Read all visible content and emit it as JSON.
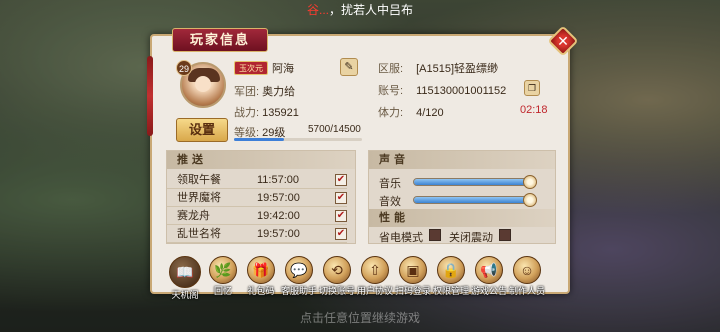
{
  "marquee": {
    "prefix": "",
    "name": "谷...",
    "suffix": "，扰若人中吕布"
  },
  "bottom_hint": "点击任意位置继续游戏",
  "panel": {
    "title": "玩家信息",
    "close_icon": "close-icon"
  },
  "player": {
    "level_badge": "29",
    "vip_tag": "玉次元",
    "name": "阿海",
    "legion_label": "军团:",
    "legion": "奥力给",
    "power_label": "战力:",
    "power": "135921",
    "level_label": "等级:",
    "level": "29级",
    "exp": "5700/14500",
    "exp_fraction": 0.393,
    "server_label": "区服:",
    "server": "[A1515]轻盈缥缈",
    "account_label": "账号:",
    "account": "115130001001152",
    "stamina_label": "体力:",
    "stamina": "4/120",
    "stamina_timer": "02:18",
    "setup_button": "设置"
  },
  "push": {
    "header": "推送",
    "items": [
      {
        "name": "领取午餐",
        "time": "11:57:00",
        "checked": "✔"
      },
      {
        "name": "世界魔将",
        "time": "19:57:00",
        "checked": "✔"
      },
      {
        "name": "赛龙舟",
        "time": "19:42:00",
        "checked": "✔"
      },
      {
        "name": "乱世名将",
        "time": "19:57:00",
        "checked": "✔"
      }
    ]
  },
  "sound": {
    "header": "声音",
    "music_label": "音乐",
    "music_level": 0.98,
    "effect_label": "音效",
    "effect_level": 0.98
  },
  "performance": {
    "header": "性能",
    "power_save_label": "省电模式",
    "vibration_off_label": "关闭震动"
  },
  "bottom_icons": [
    {
      "label": "天机阁",
      "glyph": "📖"
    },
    {
      "label": "回忆",
      "glyph": "🌿"
    },
    {
      "label": "礼包码",
      "glyph": "🎁"
    },
    {
      "label": "客服助手",
      "glyph": "💬"
    },
    {
      "label": "切换账号",
      "glyph": "⟲"
    },
    {
      "label": "用户协议",
      "glyph": "⇧"
    },
    {
      "label": "扫码登录",
      "glyph": "▣"
    },
    {
      "label": "权限管理",
      "glyph": "🔒"
    },
    {
      "label": "游戏公告",
      "glyph": "📢"
    },
    {
      "label": "制作人员",
      "glyph": "☺"
    }
  ]
}
